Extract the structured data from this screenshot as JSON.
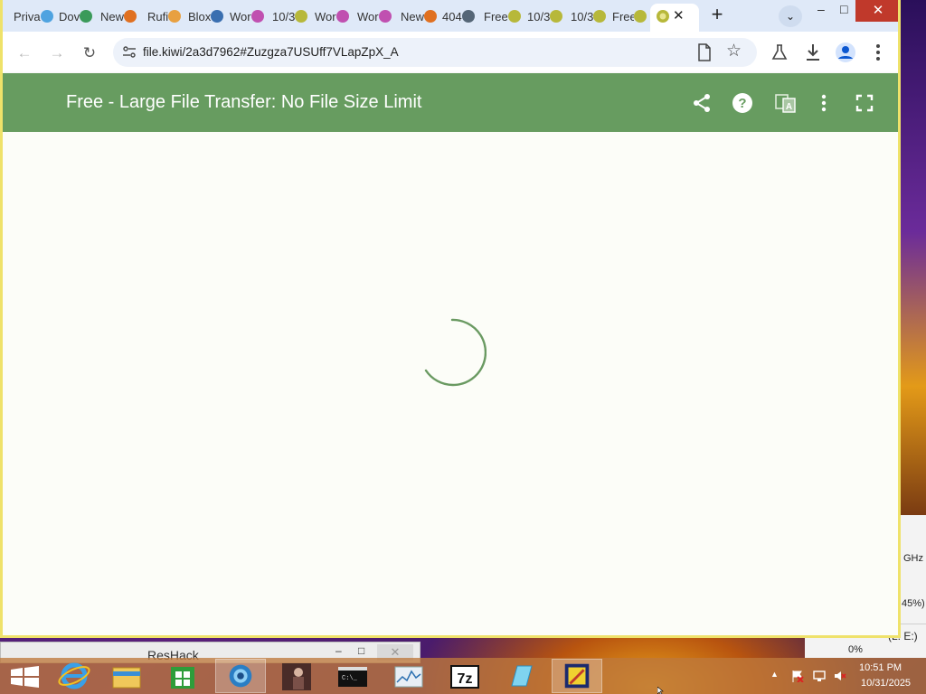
{
  "browser": {
    "tabs": [
      {
        "label": "Privacy e",
        "favicon": "privacy-icon",
        "color": "#4fa3e0"
      },
      {
        "label": "Dov",
        "favicon": "arrow-icon",
        "color": "#3b9a5a"
      },
      {
        "label": "New",
        "favicon": "circle-orange-icon",
        "color": "#e07020"
      },
      {
        "label": "Rufi",
        "favicon": "rufus-icon",
        "color": "#e8a040"
      },
      {
        "label": "Blox",
        "favicon": "blox-icon",
        "color": "#3a6fb0"
      },
      {
        "label": "Wor",
        "favicon": "wordpress-swirl-icon",
        "color": "#c050b0"
      },
      {
        "label": "10/3",
        "favicon": "kiwi-icon",
        "color": "#b7b83a"
      },
      {
        "label": "Wor",
        "favicon": "wordpress-swirl-icon",
        "color": "#c050b0"
      },
      {
        "label": "Wor",
        "favicon": "wordpress-swirl-icon",
        "color": "#c050b0"
      },
      {
        "label": "New",
        "favicon": "circle-orange-icon",
        "color": "#e07020"
      },
      {
        "label": "404",
        "favicon": "globe-icon",
        "color": "#556677"
      },
      {
        "label": "Free",
        "favicon": "kiwi-icon",
        "color": "#b7b83a"
      },
      {
        "label": "10/3",
        "favicon": "kiwi-icon",
        "color": "#b7b83a"
      },
      {
        "label": "10/3",
        "favicon": "kiwi-icon",
        "color": "#b7b83a"
      },
      {
        "label": "Free",
        "favicon": "kiwi-icon",
        "color": "#b7b83a"
      }
    ],
    "active_tab_favicon": "kiwi-icon",
    "address": "file.kiwi/2a3d7962#Zuzgza7USUff7VLapZpX_A"
  },
  "app": {
    "title": "Free - Large File Transfer: No File Size Limit",
    "accent_color": "#679c60"
  },
  "background_window": {
    "ghz": "GHz",
    "percent": "45%)",
    "drive": "(L: E:)",
    "drive_usage": "0%"
  },
  "reshack": {
    "title": "ResHack"
  },
  "taskbar": {
    "time": "10:51 PM",
    "date": "10/31/2025",
    "items": [
      "windows-start-icon",
      "internet-explorer-icon",
      "file-explorer-icon",
      "store-icon",
      "browser-globe-icon",
      "photo-app-icon",
      "command-prompt-icon",
      "performance-monitor-icon",
      "7zip-icon",
      "notepad-icon",
      "reshack-icon"
    ]
  }
}
